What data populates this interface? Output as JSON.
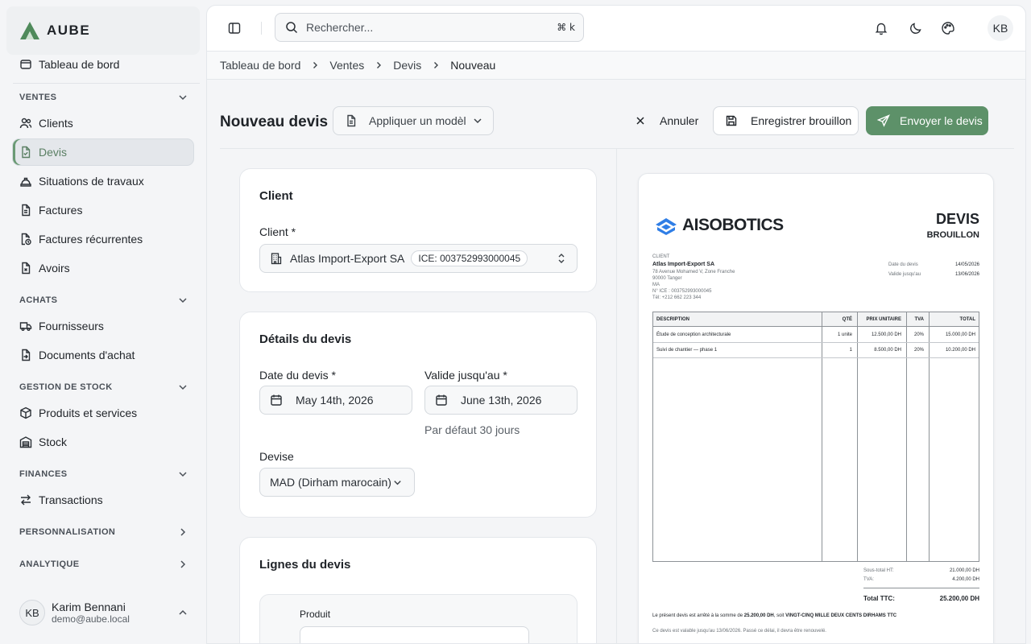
{
  "brand": {
    "name": "AUBE",
    "accent": "#5d9169"
  },
  "sidebar": {
    "top_item": {
      "label": "Tableau de bord",
      "icon": "window-icon"
    },
    "sections": [
      {
        "title": "VENTES",
        "items": [
          "Clients",
          "Devis",
          "Situations de travaux",
          "Factures",
          "Factures récurrentes",
          "Avoirs"
        ]
      },
      {
        "title": "ACHATS",
        "items": [
          "Fournisseurs",
          "Documents d'achat"
        ]
      },
      {
        "title": "GESTION DE STOCK",
        "items": [
          "Produits et services",
          "Stock"
        ]
      },
      {
        "title": "FINANCES",
        "items": [
          "Transactions"
        ]
      },
      {
        "title": "PERSONNALISATION",
        "items": []
      },
      {
        "title": "ANALYTIQUE",
        "items": []
      }
    ],
    "active": "Devis",
    "user": {
      "initials": "KB",
      "name": "Karim Bennani",
      "email": "demo@aube.local"
    }
  },
  "topbar": {
    "search_placeholder": "Rechercher...",
    "shortcut": "⌘ k",
    "avatar": "KB"
  },
  "breadcrumb": [
    "Tableau de bord",
    "Ventes",
    "Devis",
    "Nouveau"
  ],
  "page": {
    "title": "Nouveau devis",
    "model_button": "Appliquer un modèl",
    "cancel": "Annuler",
    "save_draft": "Enregistrer brouillon",
    "send": "Envoyer le devis"
  },
  "form": {
    "client_card": {
      "title": "Client",
      "client_label": "Client *",
      "client_value": "Atlas Import-Export SA",
      "ice_badge": "ICE: 003752993000045"
    },
    "details_card": {
      "title": "Détails du devis",
      "date_label": "Date du devis *",
      "date_value": "May 14th, 2026",
      "valid_label": "Valide jusqu'au *",
      "valid_value": "June 13th, 2026",
      "valid_hint": "Par défaut 30 jours",
      "currency_label": "Devise",
      "currency_value": "MAD (Dirham marocain)"
    },
    "lines_card": {
      "title": "Lignes du devis",
      "product_label": "Produit"
    }
  },
  "preview": {
    "company": "AISOBOTICS",
    "doc_title": "DEVIS",
    "status": "BROUILLON",
    "client_heading": "CLIENT",
    "client_name": "Atlas Import-Export SA",
    "client_address": [
      "78 Avenue Mohamed V, Zone Franche",
      "90000 Tanger",
      "MA",
      "N° ICE : 003752993000045",
      "Tél: +212 662 223 344"
    ],
    "meta": [
      {
        "label": "Date du devis",
        "value": "14/05/2026"
      },
      {
        "label": "Valide jusqu'au",
        "value": "13/06/2026"
      }
    ],
    "table": {
      "headers": [
        "DESCRIPTION",
        "QTÉ",
        "PRIX UNITAIRE",
        "TVA",
        "TOTAL"
      ],
      "rows": [
        [
          "Étude de conception architecturale",
          "1 unite",
          "12.500,00 DH",
          "20%",
          "15.000,00 DH"
        ],
        [
          "Suivi de chantier — phase 1",
          "1",
          "8.500,00 DH",
          "20%",
          "10.200,00 DH"
        ]
      ]
    },
    "subtotal_label": "Sous-total HT:",
    "subtotal_value": "21.000,00 DH",
    "tva_label": "TVA:",
    "tva_value": "4.200,00 DH",
    "total_label": "Total TTC:",
    "total_value": "25.200,00 DH",
    "amount_sentence_a": "Le présent devis est arrêté à la somme de ",
    "amount_sentence_b": "25.200,00 DH",
    "amount_sentence_c": ", soit ",
    "amount_sentence_d": "VINGT-CINQ MILLE DEUX CENTS DIRHAMS TTC",
    "validity_note": "Ce devis est valable jusqu'au 13/06/2026. Passé ce délai, il devra être renouvelé."
  }
}
